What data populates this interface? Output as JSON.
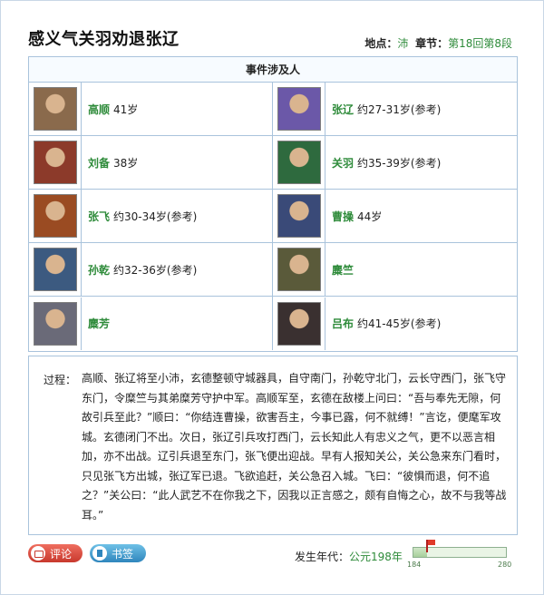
{
  "header": {
    "title": "感义气关羽劝退张辽",
    "location_label": "地点：",
    "location_value": "沛",
    "chapter_label": "章节：",
    "chapter_value": "第18回第8段"
  },
  "people": {
    "heading": "事件涉及人",
    "items": [
      {
        "name": "高顺",
        "age": "41岁",
        "color": "#8a6a4c"
      },
      {
        "name": "张辽",
        "age": "约27-31岁(参考)",
        "color": "#6b58a8"
      },
      {
        "name": "刘备",
        "age": "38岁",
        "color": "#8c3a2a"
      },
      {
        "name": "关羽",
        "age": "约35-39岁(参考)",
        "color": "#2e6a3e"
      },
      {
        "name": "张飞",
        "age": "约30-34岁(参考)",
        "color": "#9a4b22"
      },
      {
        "name": "曹操",
        "age": "44岁",
        "color": "#3a4a78"
      },
      {
        "name": "孙乾",
        "age": "约32-36岁(参考)",
        "color": "#3c5a80"
      },
      {
        "name": "麋竺",
        "age": "",
        "color": "#5a5a3a"
      },
      {
        "name": "麋芳",
        "age": "",
        "color": "#6a6a78"
      },
      {
        "name": "吕布",
        "age": "约41-45岁(参考)",
        "color": "#3a3030"
      }
    ]
  },
  "process": {
    "label": "过程：",
    "text": "高顺、张辽将至小沛，玄德整顿守城器具，自守南门，孙乾守北门，云长守西门，张飞守东门，令糜竺与其弟糜芳守护中军。高顺军至，玄德在敌楼上问曰：“吾与奉先无隙，何故引兵至此？”顺曰：“你结连曹操，欲害吾主，今事已露，何不就缚！”言讫，便麾军攻城。玄德闭门不出。次日，张辽引兵攻打西门，云长知此人有忠义之气，更不以恶言相加，亦不出战。辽引兵退至东门，张飞便出迎战。早有人报知关公，关公急来东门看时，只见张飞方出城，张辽军已退。飞欲追赶，关公急召入城。飞曰：“彼惧而退，何不追之？”关公曰：“此人武艺不在你我之下，因我以正言感之，颇有自悔之心，故不与我等战耳。”"
  },
  "footer": {
    "comment_label": "评论",
    "bookmark_label": "书签",
    "era_label": "发生年代：",
    "era_value": "公元198年",
    "timeline_min": "184",
    "timeline_max": "280",
    "timeline_current": 198,
    "colors": {
      "accent_green": "#2e8b3a",
      "comment_red": "#c8382d",
      "bookmark_blue": "#2f86bd"
    }
  }
}
